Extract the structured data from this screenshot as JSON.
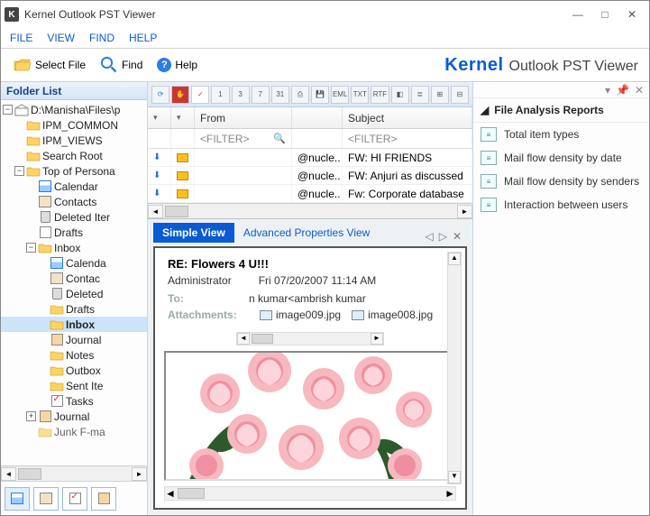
{
  "window": {
    "title": "Kernel Outlook PST Viewer"
  },
  "menu": {
    "file": "FILE",
    "view": "VIEW",
    "find": "FIND",
    "help": "HELP"
  },
  "toolbar": {
    "select_file": "Select File",
    "find": "Find",
    "help": "Help"
  },
  "branding": {
    "kernel": "Kernel",
    "sub": "Outlook PST Viewer"
  },
  "sidebar": {
    "header": "Folder List",
    "root": "D:\\Manisha\\Files\\p",
    "items": [
      "IPM_COMMON",
      "IPM_VIEWS",
      "Search Root",
      "Top of Persona",
      "Calendar",
      "Contacts",
      "Deleted Iter",
      "Drafts",
      "Inbox",
      "Calenda",
      "Contac",
      "Deleted",
      "Drafts",
      "Inbox",
      "Journal",
      "Notes",
      "Outbox",
      "Sent Ite",
      "Tasks",
      "Journal",
      "Junk F-ma"
    ]
  },
  "grid": {
    "columns": {
      "from": "From",
      "subject": "Subject"
    },
    "filter": "<FILTER>",
    "rows": [
      {
        "to": "@nucle..",
        "subj": "FW: HI FRIENDS"
      },
      {
        "to": "@nucle..",
        "subj": "FW: Anjuri as discussed"
      },
      {
        "to": "@nucle..",
        "subj": "Fw: Corporate database"
      }
    ]
  },
  "tabs": {
    "simple": "Simple View",
    "advanced": "Advanced Properties View"
  },
  "message": {
    "subject": "RE: Flowers 4 U!!!",
    "from": "Administrator",
    "date": "Fri 07/20/2007 11:14 AM",
    "to_label": "To:",
    "to": "n kumar<ambrish kumar",
    "attach_label": "Attachments:",
    "attachments": [
      "image009.jpg",
      "image008.jpg"
    ]
  },
  "right": {
    "header": "File Analysis Reports",
    "items": [
      "Total item types",
      "Mail flow density by date",
      "Mail flow density by senders",
      "Interaction between users"
    ]
  }
}
